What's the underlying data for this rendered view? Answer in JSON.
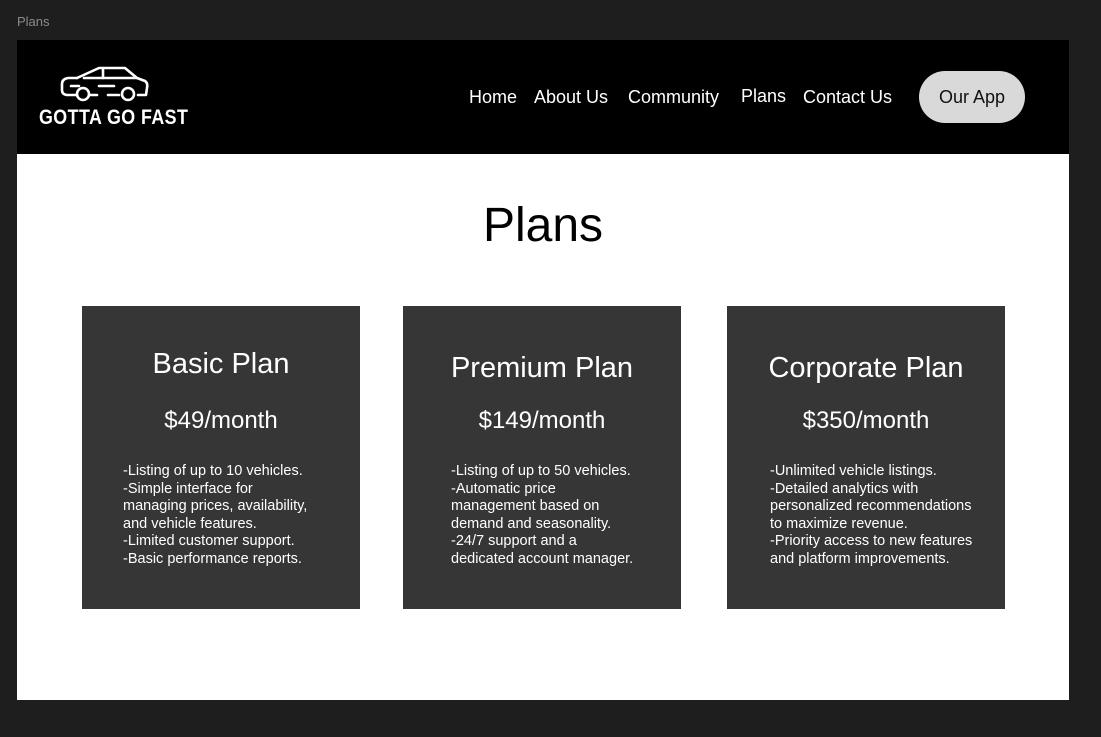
{
  "frame_label": "Plans",
  "brand": {
    "name": "GOTTA GO FAST",
    "icon": "car-icon"
  },
  "nav": {
    "items": [
      {
        "label": "Home"
      },
      {
        "label": "About Us"
      },
      {
        "label": "Community"
      },
      {
        "label": "Plans"
      },
      {
        "label": "Contact Us"
      }
    ],
    "app_button": "Our App"
  },
  "page_title": "Plans",
  "plans": [
    {
      "title": "Basic Plan",
      "price": "$49/month",
      "features": [
        "-Listing of up to 10 vehicles.",
        "-Simple interface for",
        "managing prices, availability,",
        "and vehicle features.",
        "-Limited customer support.",
        "-Basic performance reports."
      ]
    },
    {
      "title": "Premium Plan",
      "price": "$149/month",
      "features": [
        "-Listing of up to 50 vehicles.",
        "-Automatic price",
        "management based on",
        "demand and seasonality.",
        "-24/7 support and a",
        "dedicated account manager."
      ]
    },
    {
      "title": "Corporate Plan",
      "price": "$350/month",
      "features": [
        "-Unlimited vehicle listings.",
        "-Detailed analytics with",
        "personalized recommendations",
        "to maximize revenue.",
        "-Priority access to new features",
        "and platform improvements."
      ]
    }
  ],
  "colors": {
    "canvas": "#1e1e1e",
    "navbar": "#000000",
    "card": "#363636",
    "button": "#d9d9d9"
  }
}
